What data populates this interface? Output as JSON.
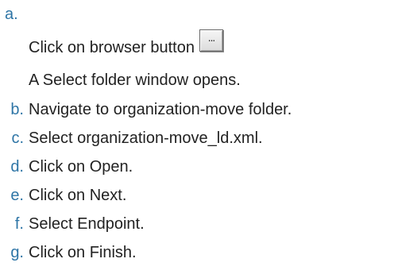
{
  "steps": [
    {
      "marker": "a.",
      "text": "Click on browser button",
      "button_label": "...",
      "note": "A Select folder window opens."
    },
    {
      "marker": "b.",
      "text": "Navigate to organization-move folder."
    },
    {
      "marker": "c.",
      "text": "Select organization-move_ld.xml."
    },
    {
      "marker": "d.",
      "text": "Click on Open."
    },
    {
      "marker": "e.",
      "text": "Click on Next."
    },
    {
      "marker": "f.",
      "text": "Select Endpoint."
    },
    {
      "marker": "g.",
      "text": "Click on Finish."
    }
  ],
  "colors": {
    "marker": "#2e75a6",
    "text": "#222222"
  }
}
